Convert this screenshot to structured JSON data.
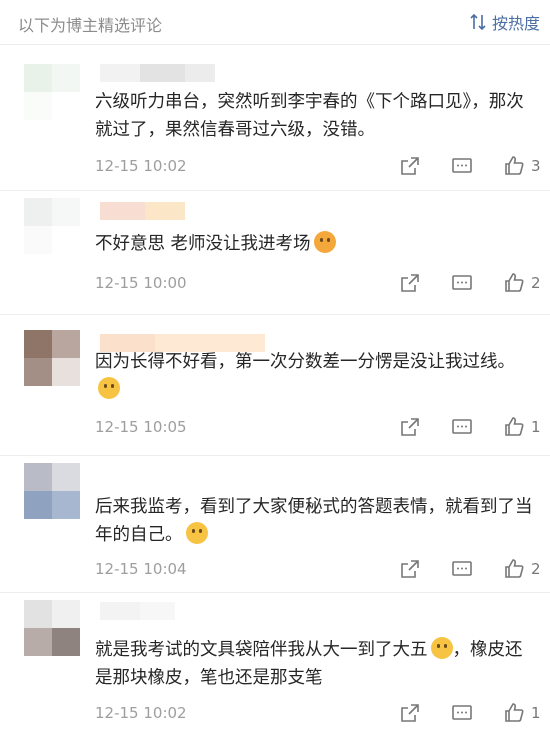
{
  "header": {
    "title": "以下为博主精选评论",
    "sort_label": "按热度"
  },
  "comments": [
    {
      "text": "六级听力串台，突然听到李宇春的《下个路口见》，那次就过了，果然信春哥过六级，没错。",
      "emoji": "",
      "time": "12-15 10:02",
      "likes": "3"
    },
    {
      "text": "不好意思 老师没让我进考场",
      "emoji": "yum-face-icon",
      "time": "12-15 10:00",
      "likes": "2"
    },
    {
      "text": "因为长得不好看，第一次分数差一分愣是没让我过线。",
      "emoji": "smile-face-icon",
      "time": "12-15 10:05",
      "likes": "1"
    },
    {
      "text": "后来我监考，看到了大家便秘式的答题表情，就看到了当年的自己。",
      "emoji": "laugh-cry-face-icon",
      "time": "12-15 10:04",
      "likes": "2"
    },
    {
      "text_a": "就是我考试的文具袋陪伴我从大一到了大五",
      "emoji": "smile-face-icon",
      "text_b": "，橡皮还是那块橡皮，笔也还是那支笔",
      "time": "12-15 10:02",
      "likes": "1"
    }
  ],
  "colors": {
    "accent": "#4b6ea3",
    "muted": "#9e9e9e",
    "divider": "#ededed"
  }
}
